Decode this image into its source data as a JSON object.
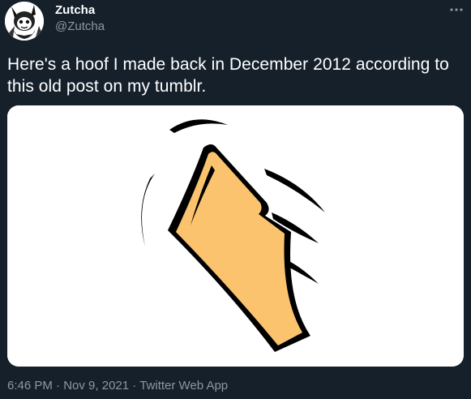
{
  "user": {
    "display_name": "Zutcha",
    "handle": "@Zutcha",
    "avatar_icon": "character-avatar-icon"
  },
  "more_icon": "ellipsis-icon",
  "tweet": {
    "text": "Here's a hoof I made back in December 2012 according to this old post on my tumblr."
  },
  "media": {
    "image_icon": "hoof-drawing-image",
    "colors": {
      "fill": "#fcc36f",
      "outline": "#000000",
      "background": "#ffffff"
    }
  },
  "meta": {
    "time": "6:46 PM",
    "separator": "·",
    "date": "Nov 9, 2021",
    "source": "Twitter Web App"
  },
  "colors": {
    "background": "#15202b",
    "text": "#ffffff",
    "secondary": "#8b98a5"
  }
}
